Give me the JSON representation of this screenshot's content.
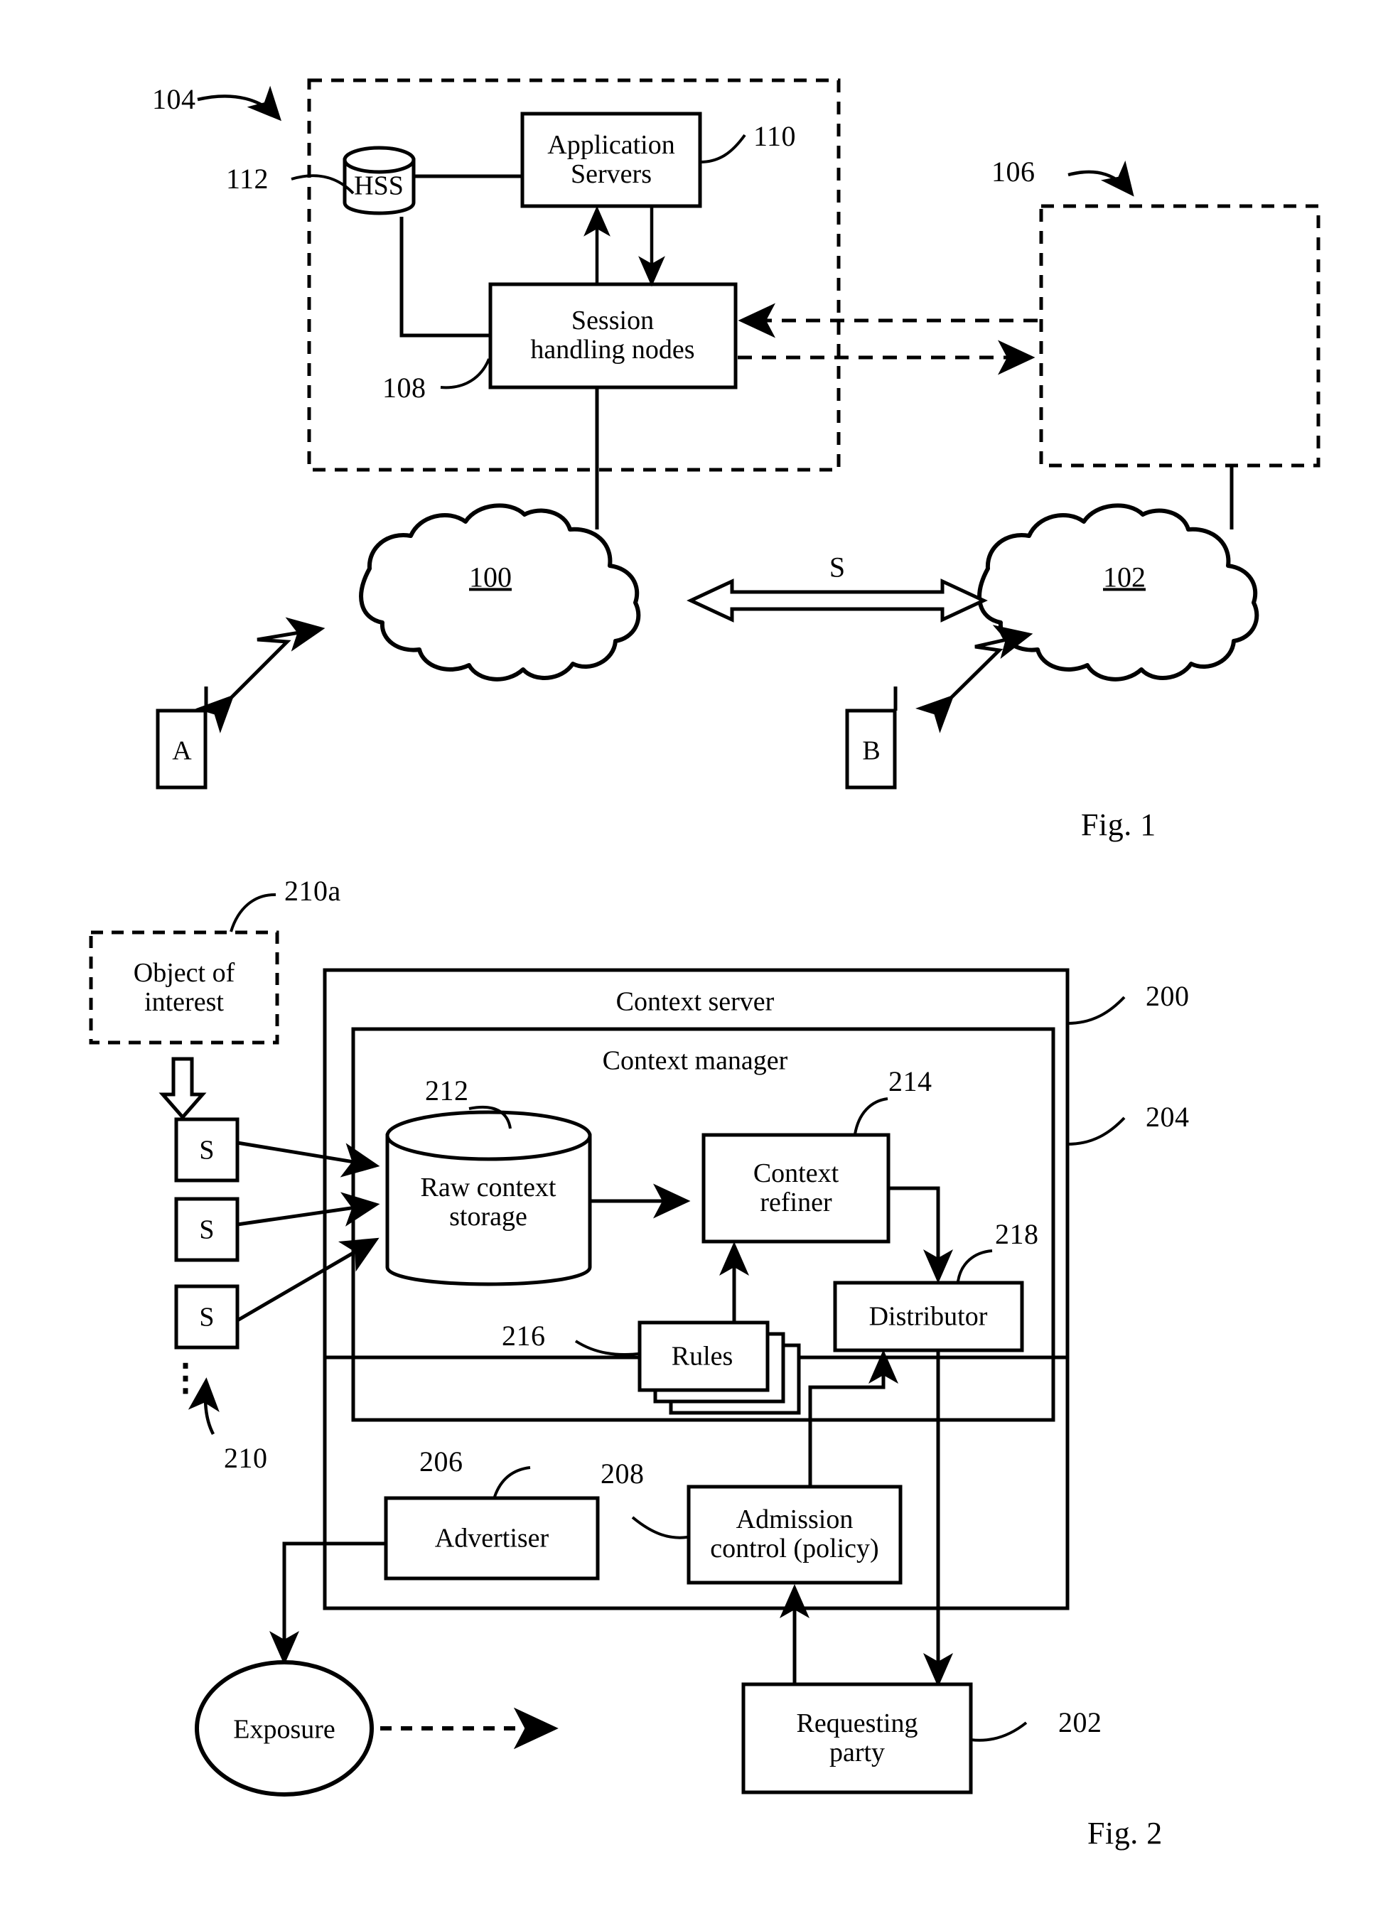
{
  "figure1": {
    "caption": "Fig. 1",
    "nodes": {
      "hss": "HSS",
      "application_servers": "Application\nServers",
      "session_handling_nodes": "Session\nhandling nodes",
      "cloud_left": "100",
      "cloud_right": "102",
      "terminal_a": "A",
      "terminal_b": "B",
      "interface_s": "S"
    },
    "reference_numerals": {
      "network_domain": "104",
      "hss": "112",
      "application_servers": "110",
      "session_handling_nodes": "108",
      "peer_domain": "106"
    }
  },
  "figure2": {
    "caption": "Fig. 2",
    "nodes": {
      "object_of_interest": "Object of\ninterest",
      "sensor": "S",
      "context_server": "Context server",
      "context_manager": "Context manager",
      "raw_context_storage": "Raw context\nstorage",
      "context_refiner": "Context\nrefiner",
      "rules": "Rules",
      "distributor": "Distributor",
      "advertiser": "Advertiser",
      "admission_control": "Admission\ncontrol (policy)",
      "exposure": "Exposure",
      "requesting_party": "Requesting\nparty"
    },
    "sensors": [
      "S",
      "S",
      "S"
    ],
    "vertical_ellipsis": "⋮",
    "reference_numerals": {
      "object_of_interest": "210a",
      "sensors_group": "210",
      "context_server": "200",
      "context_manager": "204",
      "raw_context_storage": "212",
      "context_refiner": "214",
      "rules": "216",
      "distributor": "218",
      "advertiser": "206",
      "admission_control": "208",
      "requesting_party": "202"
    }
  },
  "colors": {
    "ink": "#000000",
    "paper": "#ffffff"
  }
}
